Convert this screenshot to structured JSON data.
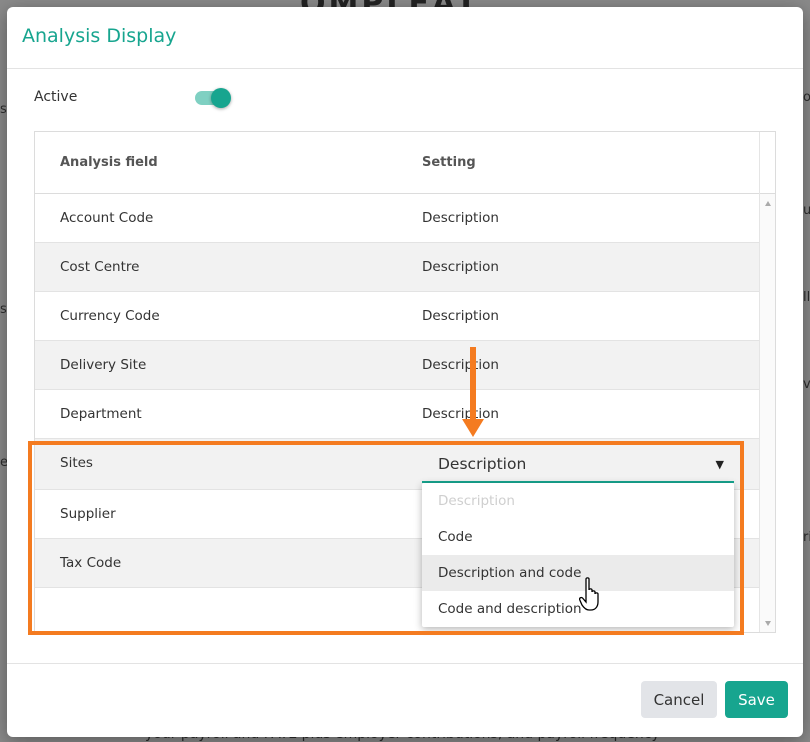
{
  "background": {
    "logo_fragment": "OMPLEAT",
    "footer_fragment": "your payroll and PAYE plus employer contributions, and payroll frequency",
    "left_fragments": [
      "s",
      "s",
      "e"
    ],
    "right_fragments": [
      "o",
      "u",
      "ll",
      "v",
      "ri"
    ]
  },
  "dialog": {
    "title": "Analysis Display",
    "active_label": "Active",
    "active_on": true,
    "accent_color": "#17a58f",
    "highlight_color": "#f47b20"
  },
  "table": {
    "headers": {
      "field": "Analysis field",
      "setting": "Setting"
    },
    "rows": [
      {
        "field": "Account Code",
        "setting": "Description"
      },
      {
        "field": "Cost Centre",
        "setting": "Description"
      },
      {
        "field": "Currency Code",
        "setting": "Description"
      },
      {
        "field": "Delivery Site",
        "setting": "Description"
      },
      {
        "field": "Department",
        "setting": "Description"
      },
      {
        "field": "Sites",
        "setting": "Description"
      },
      {
        "field": "Supplier",
        "setting": ""
      },
      {
        "field": "Tax Code",
        "setting": ""
      }
    ]
  },
  "dropdown": {
    "selected": "Description",
    "options": [
      "Description",
      "Code",
      "Description and code",
      "Code and description"
    ],
    "disabled_option": "Description",
    "hovered_option": "Description and code"
  },
  "footer": {
    "cancel_label": "Cancel",
    "save_label": "Save"
  }
}
